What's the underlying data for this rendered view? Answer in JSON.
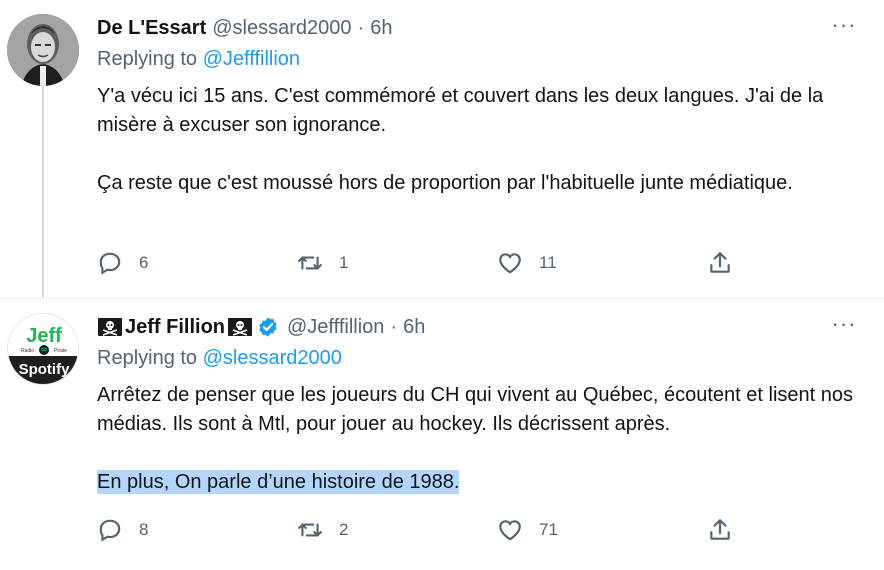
{
  "tweets": [
    {
      "display_name": "De L'Essart",
      "handle": "@slessard2000",
      "separator": "·",
      "time": "6h",
      "reply_prefix": "Replying to",
      "reply_to": "@Jefffillion",
      "paragraphs": [
        "Y'a vécu ici 15 ans. C'est commémoré et couvert dans les deux langues. J'ai de la misère à excuser son ignorance.",
        "Ça reste que c'est moussé hors de proportion par l'habituelle junte médiatique."
      ],
      "replies": "6",
      "retweets": "1",
      "likes": "11",
      "avatar_icon": "portrait-photo"
    },
    {
      "display_name_prefix_icon": "skull-crossbones-flag-icon",
      "display_name": "Jeff Fillion",
      "display_name_suffix_icon": "skull-crossbones-flag-icon",
      "verified": true,
      "handle": "@Jefffillion",
      "separator": "·",
      "time": "6h",
      "reply_prefix": "Replying to",
      "reply_to": "@slessard2000",
      "paragraphs": [
        "Arrêtez de penser que les joueurs du CH qui vivent au Québec, écoutent et lisent nos médias. Ils sont à Mtl, pour jouer au hockey. Ils décrissent après.",
        "En plus, On parle d’une histoire de 1988."
      ],
      "replies": "8",
      "retweets": "2",
      "likes": "71",
      "avatar": {
        "top_text": "Jeff",
        "middle_left": "Radio",
        "middle_right": "Pirate",
        "bottom_text": "Spotify"
      }
    }
  ],
  "more_icon": "more-horizontal-icon",
  "colors": {
    "text": "#0f1419",
    "secondary": "#536471",
    "link": "#1d9bf0",
    "verified": "#1d9bf0",
    "selection": "#b5d6fc",
    "thread_line": "#cfd9de"
  }
}
